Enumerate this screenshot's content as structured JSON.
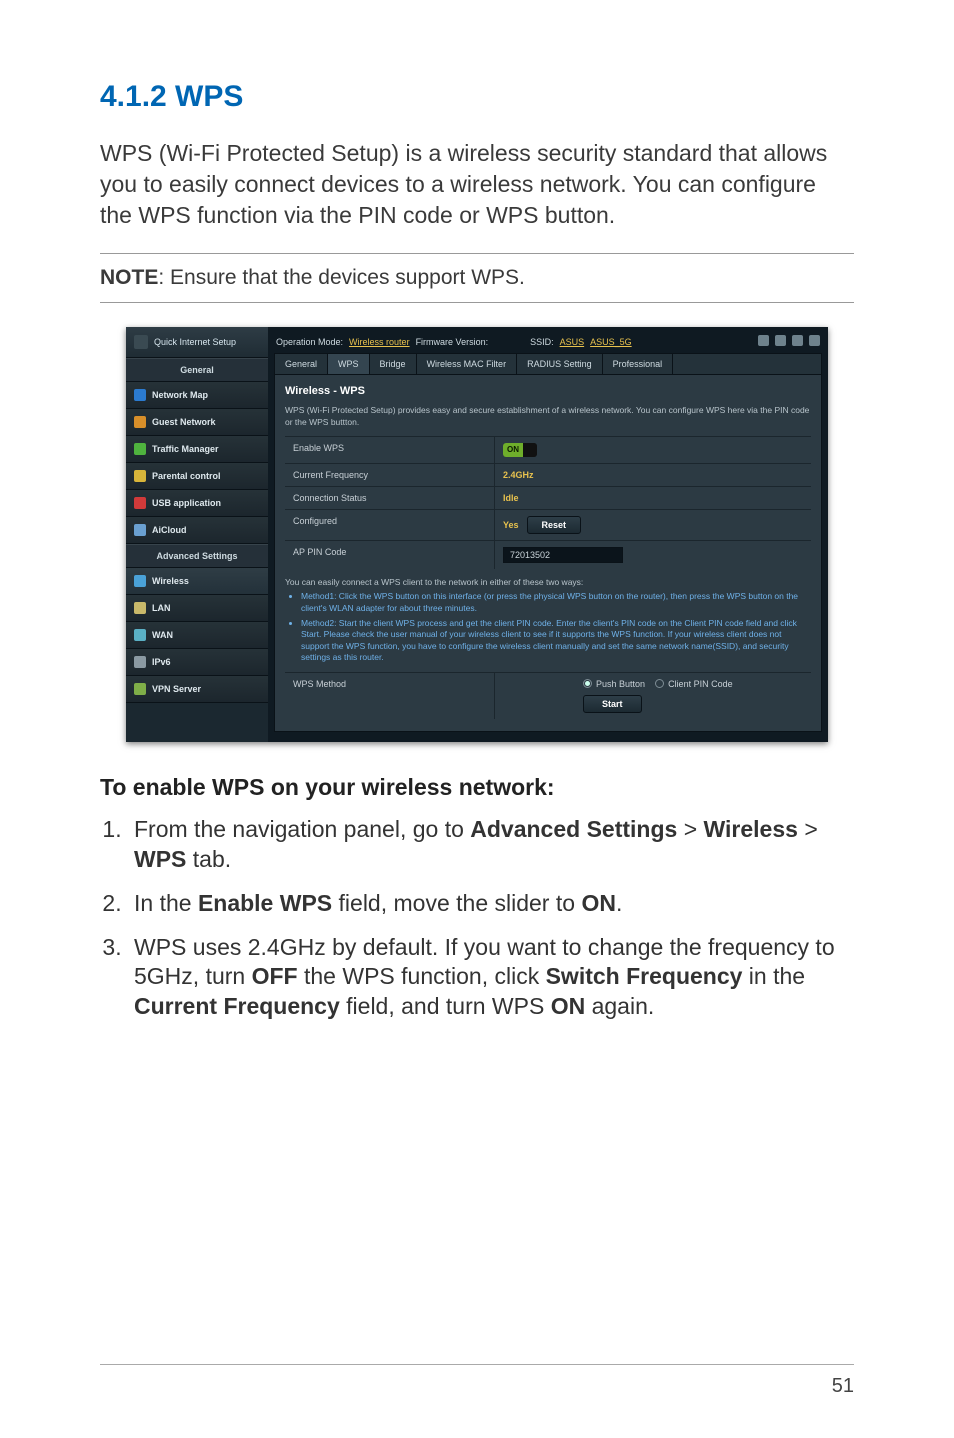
{
  "section": {
    "number_title": "4.1.2 WPS",
    "intro": "WPS (Wi-Fi Protected Setup) is a wireless security standard that allows you to easily connect devices to a wireless network. You can configure the WPS function via the PIN code or WPS button.",
    "note_label": "NOTE",
    "note_text": ":  Ensure that the devices support WPS."
  },
  "router": {
    "qis": "Quick Internet Setup",
    "side_general_label": "General",
    "side_advanced_label": "Advanced Settings",
    "side_items_general": [
      "Network Map",
      "Guest Network",
      "Traffic Manager",
      "Parental control",
      "USB application",
      "AiCloud"
    ],
    "side_items_advanced": [
      "Wireless",
      "LAN",
      "WAN",
      "IPv6",
      "VPN Server"
    ],
    "opbar": {
      "opmode_label": "Operation Mode:",
      "opmode_value": "Wireless router",
      "fw_label": "Firmware Version:",
      "ssid_label": "SSID:",
      "ssid1": "ASUS",
      "ssid2": "ASUS_5G"
    },
    "tabs": [
      "General",
      "WPS",
      "Bridge",
      "Wireless MAC Filter",
      "RADIUS Setting",
      "Professional"
    ],
    "panel_title": "Wireless - WPS",
    "panel_desc": "WPS (Wi-Fi Protected Setup) provides easy and secure establishment of a wireless network. You can configure WPS here via the PIN code or the WPS buttton.",
    "rows": {
      "enable_label": "Enable WPS",
      "enable_value": "ON",
      "freq_label": "Current Frequency",
      "freq_value": "2.4GHz",
      "status_label": "Connection Status",
      "status_value": "Idle",
      "configured_label": "Configured",
      "configured_value": "Yes",
      "reset_btn": "Reset",
      "pin_label": "AP PIN Code",
      "pin_value": "72013502"
    },
    "twoways_lead": "You can easily connect a WPS client to the network in either of these two ways:",
    "method1": "Method1: Click the WPS button on this interface (or press the physical WPS button on the router), then press the WPS button on the client's WLAN adapter for about three minutes.",
    "method2": "Method2: Start the client WPS process and get the client PIN code. Enter the client's PIN code on the Client PIN code field and click Start. Please check the user manual of your wireless client to see if it supports the WPS function. If your wireless client does not support the WPS function, you have to configure the wireless client manually and set the same network name(SSID), and security settings as this router.",
    "wps_method_label": "WPS Method",
    "radio_push": "Push Button",
    "radio_pin": "Client PIN Code",
    "start_btn": "Start"
  },
  "howto": {
    "heading": "To enable WPS on your wireless network:",
    "step1_a": "From the navigation panel, go to ",
    "step1_b": "Advanced Settings",
    "step1_c": " > ",
    "step1_d": "Wireless",
    "step1_e": " > ",
    "step1_f": "WPS",
    "step1_g": " tab.",
    "step2_a": "In the ",
    "step2_b": "Enable WPS",
    "step2_c": " field, move the slider to ",
    "step2_d": "ON",
    "step2_e": ".",
    "step3_a": "WPS uses 2.4GHz by default. If you want to change the frequency to 5GHz, turn ",
    "step3_b": "OFF",
    "step3_c": " the WPS function, click ",
    "step3_d": "Switch Frequency",
    "step3_e": " in the ",
    "step3_f": "Current Frequency",
    "step3_g": " field, and turn WPS ",
    "step3_h": "ON",
    "step3_i": " again."
  },
  "page_number": "51"
}
